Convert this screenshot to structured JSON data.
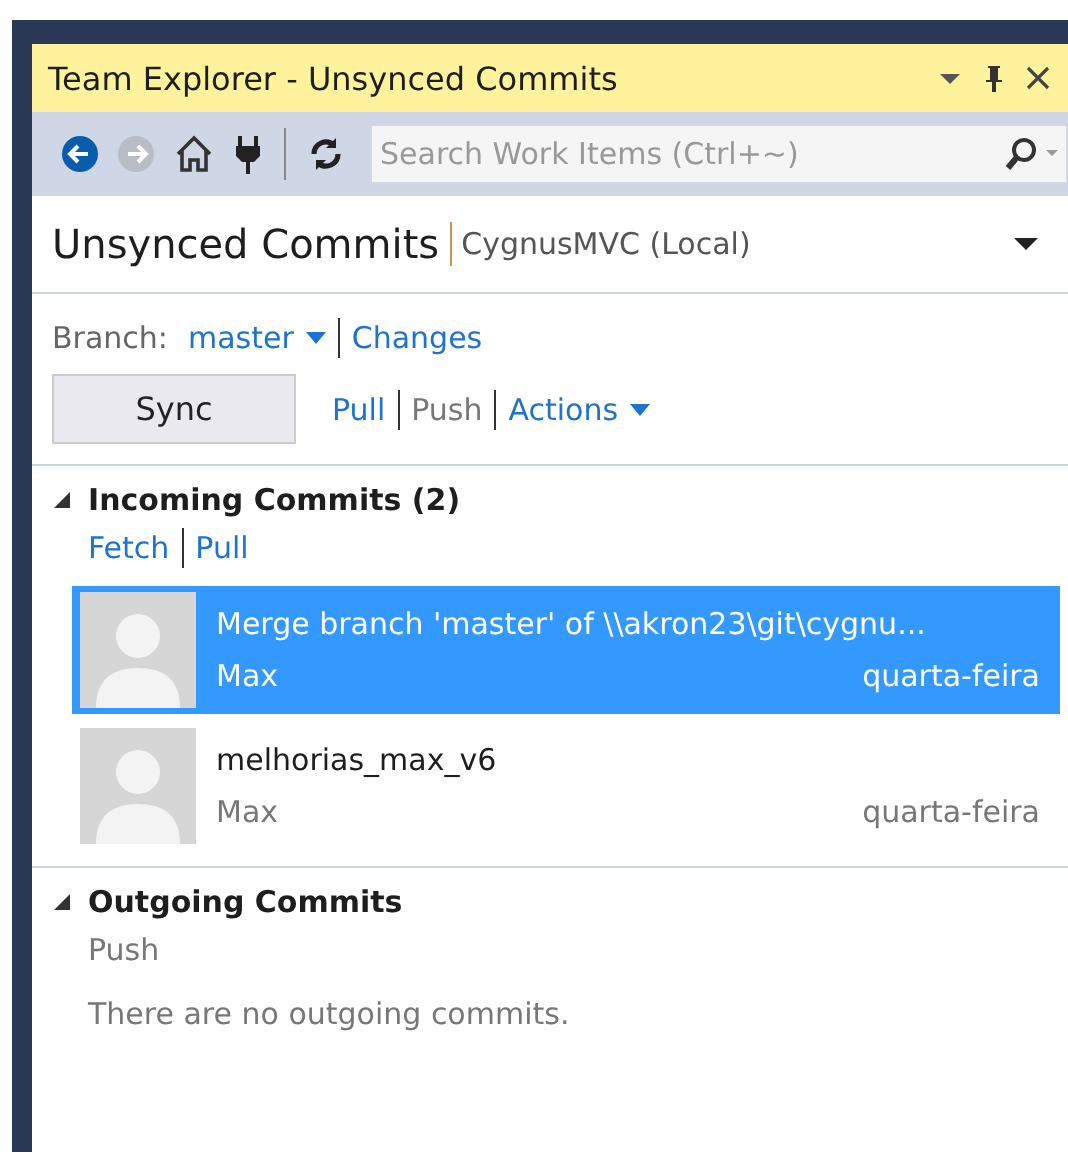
{
  "window": {
    "title": "Team Explorer - Unsynced Commits"
  },
  "toolbar": {
    "search": {
      "placeholder": "Search Work Items (Ctrl+~)"
    }
  },
  "header": {
    "title": "Unsynced Commits",
    "context": "CygnusMVC (Local)"
  },
  "branch": {
    "label": "Branch:",
    "value": "master",
    "links": [
      {
        "label": "Changes",
        "disabled": false
      }
    ]
  },
  "sync_button": "Sync",
  "actions": [
    {
      "label": "Pull",
      "disabled": false,
      "dropdown": false
    },
    {
      "label": "Push",
      "disabled": true,
      "dropdown": false
    },
    {
      "label": "Actions",
      "disabled": false,
      "dropdown": true
    }
  ],
  "sections": [
    {
      "title": "Incoming Commits (2)",
      "expanded": true,
      "links": [
        {
          "label": "Fetch",
          "disabled": false
        },
        {
          "label": "Pull",
          "disabled": false
        }
      ],
      "commits": [
        {
          "message": "Merge branch 'master' of \\\\akron23\\git\\cygnu...",
          "author": "Max",
          "date": "quarta-feira",
          "selected": true
        },
        {
          "message": "melhorias_max_v6",
          "author": "Max",
          "date": "quarta-feira",
          "selected": false
        }
      ]
    },
    {
      "title": "Outgoing Commits",
      "expanded": true,
      "links": [
        {
          "label": "Push",
          "disabled": true
        }
      ],
      "empty_message": "There are no outgoing commits."
    }
  ]
}
